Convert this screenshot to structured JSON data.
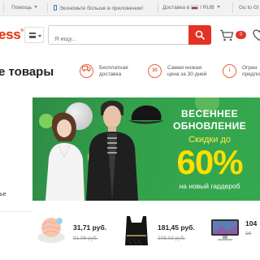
{
  "topbar": {
    "help": "Помощь",
    "app_promo": "Экономьте больше в приложении!",
    "delivery": "Доставка в",
    "currency": "RUB",
    "goto": "Go to Gl"
  },
  "header": {
    "logo_text": "ess",
    "search_placeholder": "Я ищу...",
    "cart_count": "0"
  },
  "features": {
    "title": "е товары",
    "items": [
      {
        "icon": "delivery-icon",
        "line1": "Бесплатная",
        "line2": "доставка"
      },
      {
        "icon": "30",
        "line1": "Самая низкая",
        "line2": "цена за 30 дней"
      },
      {
        "icon": "info-icon",
        "line1": "Огран",
        "line2": "предло"
      }
    ]
  },
  "sidebar": {
    "items": [
      "ье"
    ]
  },
  "banner": {
    "line1": "ВЕСЕННЕЕ",
    "line2": "ОБНОВЛЕНИЕ",
    "line3": "Скидки до",
    "percent": "60%",
    "subtitle": "на новый гардероб",
    "bg_color": "#33a04c",
    "accent_color": "#ffe000"
  },
  "products": [
    {
      "price": "31,71 руб.",
      "old_price": "91,06 руб."
    },
    {
      "price": "181,45 руб.",
      "old_price": "208,02 руб."
    },
    {
      "price": "104",
      "old_price": "16"
    }
  ],
  "colors": {
    "brand": "#e62e04",
    "search_button": "#e43225"
  }
}
